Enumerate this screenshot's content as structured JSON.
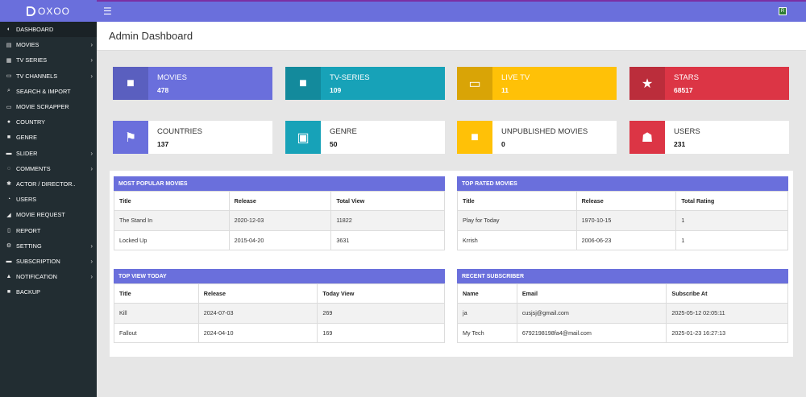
{
  "brand": {
    "name": "OXOO"
  },
  "sidebar": {
    "items": [
      {
        "label": "DASHBOARD",
        "icon": "dashboard-icon",
        "glyph": "◐",
        "chevron": false,
        "active": true
      },
      {
        "label": "MOVIES",
        "icon": "movies-icon",
        "glyph": "▤",
        "chevron": true
      },
      {
        "label": "TV SERIES",
        "icon": "tv-series-icon",
        "glyph": "▦",
        "chevron": true
      },
      {
        "label": "TV CHANNELS",
        "icon": "tv-channels-icon",
        "glyph": "▭",
        "chevron": true
      },
      {
        "label": "SEARCH & IMPORT",
        "icon": "search-icon",
        "glyph": "⌕",
        "chevron": false
      },
      {
        "label": "MOVIE SCRAPPER",
        "icon": "scrapper-icon",
        "glyph": "▭",
        "chevron": false
      },
      {
        "label": "COUNTRY",
        "icon": "globe-icon",
        "glyph": "●",
        "chevron": false
      },
      {
        "label": "GENRE",
        "icon": "genre-icon",
        "glyph": "■",
        "chevron": false
      },
      {
        "label": "SLIDER",
        "icon": "slider-icon",
        "glyph": "▬",
        "chevron": true
      },
      {
        "label": "COMMENTS",
        "icon": "comments-icon",
        "glyph": "◌",
        "chevron": true
      },
      {
        "label": "ACTOR / DIRECTOR..",
        "icon": "actor-icon",
        "glyph": "✱",
        "chevron": false
      },
      {
        "label": "USERS",
        "icon": "users-icon",
        "glyph": "◔",
        "chevron": false
      },
      {
        "label": "MOVIE REQUEST",
        "icon": "request-icon",
        "glyph": "◢",
        "chevron": false
      },
      {
        "label": "REPORT",
        "icon": "report-icon",
        "glyph": "▯",
        "chevron": false
      },
      {
        "label": "SETTING",
        "icon": "settings-icon",
        "glyph": "⚙",
        "chevron": true
      },
      {
        "label": "SUBSCRIPTION",
        "icon": "subscription-icon",
        "glyph": "▬",
        "chevron": true
      },
      {
        "label": "NOTIFICATION",
        "icon": "notification-icon",
        "glyph": "▲",
        "chevron": true
      },
      {
        "label": "BACKUP",
        "icon": "backup-icon",
        "glyph": "■",
        "chevron": false
      }
    ]
  },
  "topbar": {
    "avatar_initial": "R"
  },
  "header": {
    "title": "Admin Dashboard"
  },
  "stats": [
    {
      "label": "MOVIES",
      "value": "478",
      "icon": "video-camera-icon",
      "glyph": "■",
      "style": "solid",
      "bg": "#6a6fdc",
      "iconbg": "#5a5fbf"
    },
    {
      "label": "TV-SERIES",
      "value": "109",
      "icon": "video-camera-icon",
      "glyph": "■",
      "style": "solid",
      "bg": "#17a2b8",
      "iconbg": "#138a9c"
    },
    {
      "label": "LIVE TV",
      "value": "11",
      "icon": "monitor-icon",
      "glyph": "▭",
      "style": "solid",
      "bg": "#ffc107",
      "iconbg": "#d9a406"
    },
    {
      "label": "STARS",
      "value": "68517",
      "icon": "star-icon",
      "glyph": "★",
      "style": "solid",
      "bg": "#dc3545",
      "iconbg": "#bb2d3b"
    },
    {
      "label": "COUNTRIES",
      "value": "137",
      "icon": "flag-icon",
      "glyph": "⚑",
      "style": "white",
      "iconbg": "#6a6fdc"
    },
    {
      "label": "GENRE",
      "value": "50",
      "icon": "archive-icon",
      "glyph": "▣",
      "style": "white",
      "iconbg": "#17a2b8"
    },
    {
      "label": "UNPUBLISHED MOVIES",
      "value": "0",
      "icon": "video-camera-icon",
      "glyph": "■",
      "style": "white",
      "iconbg": "#ffc107"
    },
    {
      "label": "USERS",
      "value": "231",
      "icon": "users-group-icon",
      "glyph": "☗",
      "style": "white",
      "iconbg": "#dc3545"
    }
  ],
  "tables": {
    "popular": {
      "title": "MOST POPULAR MOVIES",
      "headers": [
        "Title",
        "Release",
        "Total View"
      ],
      "rows": [
        [
          "The Stand In",
          "2020-12-03",
          "11822"
        ],
        [
          "Locked Up",
          "2015-04-20",
          "3631"
        ]
      ]
    },
    "top_rated": {
      "title": "TOP RATED MOVIES",
      "headers": [
        "Title",
        "Release",
        "Total Rating"
      ],
      "rows": [
        [
          "Play for Today",
          "1970-10-15",
          "1"
        ],
        [
          "Krrish",
          "2006-06-23",
          "1"
        ]
      ]
    },
    "top_view": {
      "title": "TOP VIEW TODAY",
      "headers": [
        "Title",
        "Release",
        "Today View"
      ],
      "rows": [
        [
          "Kill",
          "2024-07-03",
          "269"
        ],
        [
          "Fallout",
          "2024-04-10",
          "169"
        ]
      ]
    },
    "subscribers": {
      "title": "RECENT SUBSCRIBER",
      "headers": [
        "Name",
        "Email",
        "Subscribe At"
      ],
      "rows": [
        [
          "ja",
          "cusjsj@gmail.com",
          "2025-05-12 02:05:11"
        ],
        [
          "My Tech",
          "6792198198fa4@mail.com",
          "2025-01-23 16:27:13"
        ]
      ]
    }
  }
}
